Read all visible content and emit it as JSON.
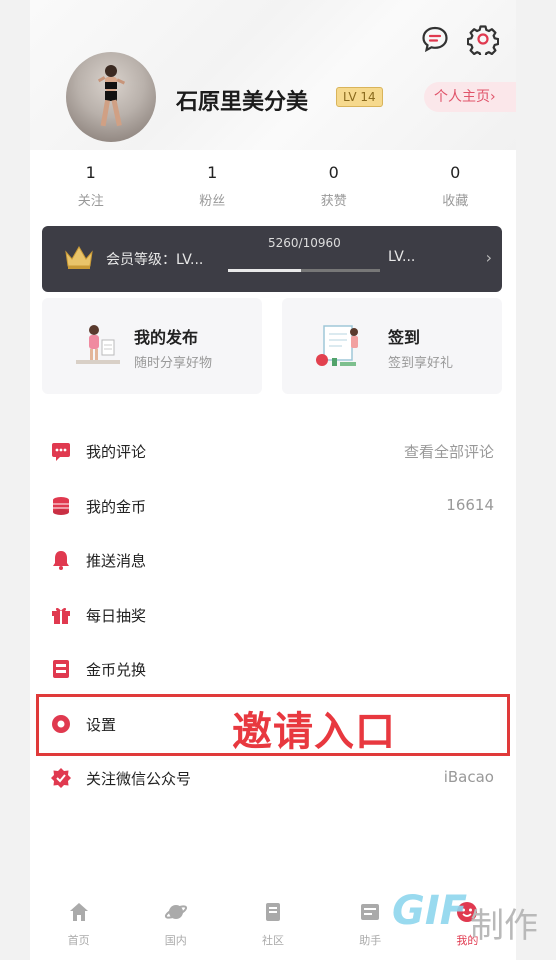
{
  "header": {
    "username": "石原里美分美",
    "level_badge": "LV 14",
    "home_button": "个人主页›"
  },
  "stats": [
    {
      "num": "1",
      "label": "关注"
    },
    {
      "num": "1",
      "label": "粉丝"
    },
    {
      "num": "0",
      "label": "获赞"
    },
    {
      "num": "0",
      "label": "收藏"
    }
  ],
  "member": {
    "label": "会员等级：LV...",
    "progress_text": "5260/10960",
    "progress_fraction": 0.48,
    "next_level": "LV...",
    "chevron": "›"
  },
  "cards": [
    {
      "title": "我的发布",
      "subtitle": "随时分享好物"
    },
    {
      "title": "签到",
      "subtitle": "签到享好礼"
    }
  ],
  "menu": [
    {
      "icon": "comment-icon",
      "label": "我的评论",
      "value": "查看全部评论"
    },
    {
      "icon": "coin-icon",
      "label": "我的金币",
      "value": "16614"
    },
    {
      "icon": "bell-icon",
      "label": "推送消息",
      "value": ""
    },
    {
      "icon": "gift-icon",
      "label": "每日抽奖",
      "value": ""
    },
    {
      "icon": "exchange-icon",
      "label": "金币兑换",
      "value": ""
    },
    {
      "icon": "settings-circle-icon",
      "label": "设置",
      "value": ""
    },
    {
      "icon": "wechat-badge-icon",
      "label": "关注微信公众号",
      "value": "iBacao"
    }
  ],
  "overlay": {
    "text": "邀请入口"
  },
  "tabs": [
    {
      "icon": "home-icon",
      "label": "首页"
    },
    {
      "icon": "planet-icon",
      "label": "国内"
    },
    {
      "icon": "community-icon",
      "label": "社区"
    },
    {
      "icon": "assistant-icon",
      "label": "助手"
    },
    {
      "icon": "profile-icon",
      "label": "我的"
    }
  ],
  "watermark": {
    "gif": "GIF",
    "make": "制作"
  },
  "colors": {
    "accent": "#e0394f",
    "highlight": "#e03a3a",
    "member_bg": "#3d3d45"
  }
}
